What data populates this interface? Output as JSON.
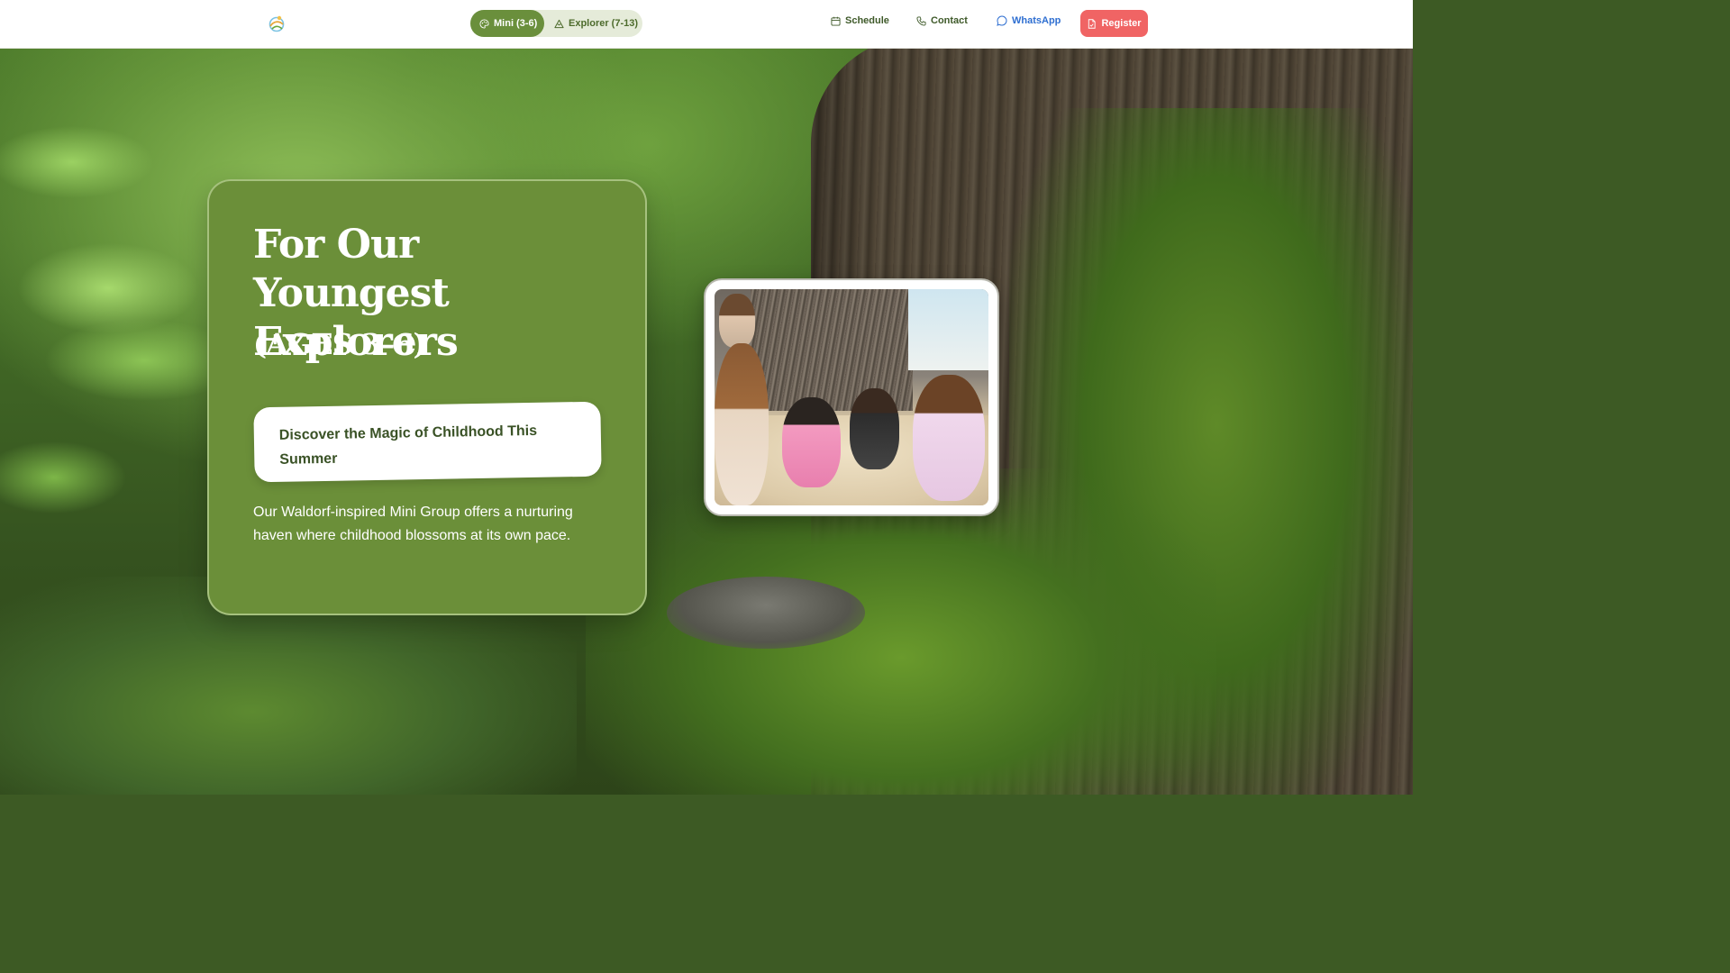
{
  "nav": {
    "mini_label": "Mini (3-6)",
    "explorer_label": "Explorer (7-13)",
    "schedule_label": "Schedule",
    "contact_label": "Contact",
    "whatsapp_label": "WhatsApp",
    "register_label": "Register",
    "active_tab": "Mini (3-6)"
  },
  "hero": {
    "title": "For Our Youngest Explorers",
    "ages": "(AGES 3–6)",
    "tagline": "Discover the Magic of Childhood This Summer",
    "description": "Our Waldorf-inspired Mini Group offers a nurturing haven where childhood blossoms at its own pace."
  },
  "icons": {
    "logo": "sun-swirl-logo",
    "mini": "palette-icon",
    "explorer": "mountain-icon",
    "schedule": "calendar-icon",
    "contact": "phone-icon",
    "whatsapp": "chat-bubble-icon",
    "register": "document-icon"
  },
  "colors": {
    "card_green": "#6b8f39",
    "active_tab": "#6a8f3c",
    "register": "#f06464",
    "whatsapp_link": "#2f6fd1"
  }
}
